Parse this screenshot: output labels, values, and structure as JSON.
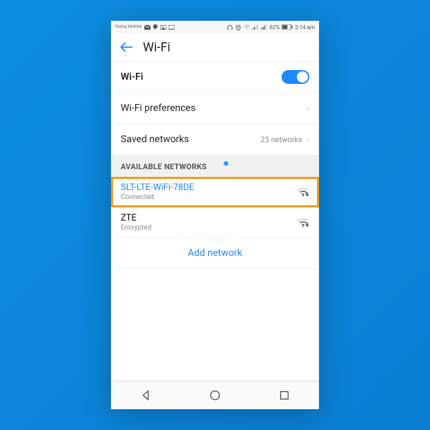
{
  "statusbar": {
    "carrier": "Dialog\nMobitel",
    "battery_pct": "62%",
    "time": "2:14 am"
  },
  "header": {
    "title": "Wi-Fi"
  },
  "settings": {
    "wifi_label": "Wi-Fi",
    "wifi_enabled": true,
    "prefs_label": "Wi-Fi preferences",
    "saved_label": "Saved networks",
    "saved_count": "25 networks"
  },
  "section_title": "AVAILABLE NETWORKS",
  "networks": [
    {
      "name": "SLT-LTE-WiFi-78DE",
      "status": "Connected",
      "connected": true,
      "highlighted": true
    },
    {
      "name": "ZTE",
      "status": "Encrypted",
      "connected": false,
      "highlighted": false
    }
  ],
  "add_network_label": "Add network"
}
